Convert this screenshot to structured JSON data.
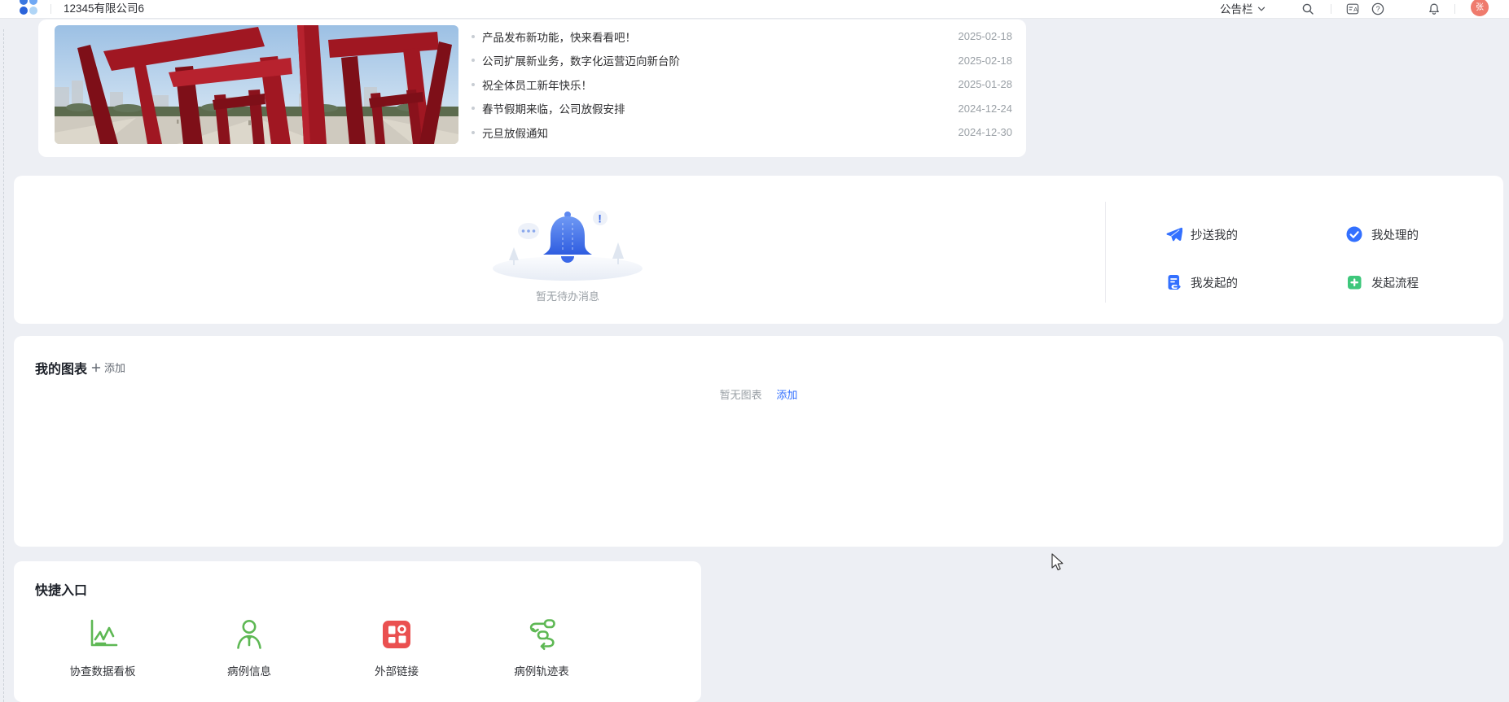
{
  "header": {
    "company_name": "12345有限公司6",
    "menu_label": "公告栏",
    "avatar_text": "张",
    "icons": [
      "search-icon",
      "translate-icon",
      "help-icon",
      "notification-bell-icon"
    ]
  },
  "announcement_board": {
    "items": [
      {
        "title": "产品发布新功能，快来看看吧！",
        "date": "2025-02-18"
      },
      {
        "title": "公司扩展新业务，数字化运营迈向新台阶",
        "date": "2025-02-18"
      },
      {
        "title": "祝全体员工新年快乐！",
        "date": "2025-01-28"
      },
      {
        "title": "春节假期来临，公司放假安排",
        "date": "2024-12-24"
      },
      {
        "title": "元旦放假通知",
        "date": "2024-12-30"
      }
    ]
  },
  "todo_panel": {
    "empty_text": "暂无待办消息",
    "actions": [
      {
        "label": "抄送我的",
        "icon": "send-plane-icon",
        "color": "#3370ff"
      },
      {
        "label": "我处理的",
        "icon": "check-circle-icon",
        "color": "#3370ff"
      },
      {
        "label": "我发起的",
        "icon": "document-send-icon",
        "color": "#3370ff"
      },
      {
        "label": "发起流程",
        "icon": "plus-square-icon",
        "color": "#3ec77b"
      }
    ]
  },
  "my_charts": {
    "title": "我的图表",
    "add_button": "添加",
    "empty_text": "暂无图表",
    "empty_add_link": "添加"
  },
  "quick_entry": {
    "title": "快捷入口",
    "items": [
      {
        "label": "协查数据看板",
        "icon": "line-chart-icon"
      },
      {
        "label": "病例信息",
        "icon": "person-icon"
      },
      {
        "label": "外部链接",
        "icon": "app-grid-icon"
      },
      {
        "label": "病例轨迹表",
        "icon": "flow-track-icon"
      }
    ]
  },
  "colors": {
    "background": "#edeff4",
    "accent_blue": "#3370ff",
    "action_green": "#3ec77b",
    "entry_green": "#5eb854",
    "entry_red": "#ea5050",
    "date_gray": "#9aa0a6",
    "avatar_bg": "#ef7b6d"
  }
}
